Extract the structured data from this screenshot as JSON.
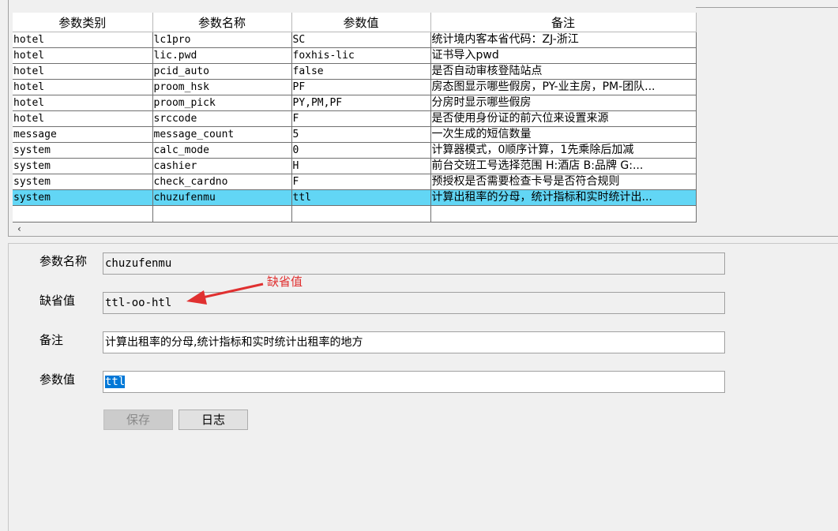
{
  "grid": {
    "columns": [
      "参数类别",
      "参数名称",
      "参数值",
      "备注"
    ],
    "rows": [
      {
        "category": "hotel",
        "name": "lc1pro",
        "value": "SC",
        "remark": "统计境内客本省代码：ZJ-浙江"
      },
      {
        "category": "hotel",
        "name": "lic.pwd",
        "value": "foxhis-lic",
        "remark": "证书导入pwd"
      },
      {
        "category": "hotel",
        "name": "pcid_auto",
        "value": "false",
        "remark": "是否自动审核登陆站点"
      },
      {
        "category": "hotel",
        "name": "proom_hsk",
        "value": "PF",
        "remark": "房态图显示哪些假房，PY-业主房，PM-团队..."
      },
      {
        "category": "hotel",
        "name": "proom_pick",
        "value": "PY,PM,PF",
        "remark": "分房时显示哪些假房"
      },
      {
        "category": "hotel",
        "name": "srccode",
        "value": "F",
        "remark": "是否使用身份证的前六位来设置来源"
      },
      {
        "category": "message",
        "name": "message_count",
        "value": "5",
        "remark": "一次生成的短信数量"
      },
      {
        "category": "system",
        "name": "calc_mode",
        "value": "0",
        "remark": "计算器模式，0顺序计算，1先乘除后加减"
      },
      {
        "category": "system",
        "name": "cashier",
        "value": "H",
        "remark": "前台交班工号选择范围 H:酒店  B:品牌 G:..."
      },
      {
        "category": "system",
        "name": "check_cardno",
        "value": "F",
        "remark": "预授权是否需要检查卡号是否符合规则"
      },
      {
        "category": "system",
        "name": "chuzufenmu",
        "value": "ttl",
        "remark": "计算出租率的分母，统计指标和实时统计出..."
      }
    ],
    "selected_index": 10,
    "scroll_left_arrow": "‹"
  },
  "form": {
    "name_label": "参数名称",
    "name_value": "chuzufenmu",
    "default_label": "缺省值",
    "default_value": "ttl-oo-htl",
    "remark_label": "备注",
    "remark_value": "计算出租率的分母,统计指标和实时统计出租率的地方",
    "value_label": "参数值",
    "value_value": "ttl",
    "save_button": "保存",
    "log_button": "日志"
  },
  "annotation": {
    "text": "缺省值",
    "color": "#e03030"
  }
}
